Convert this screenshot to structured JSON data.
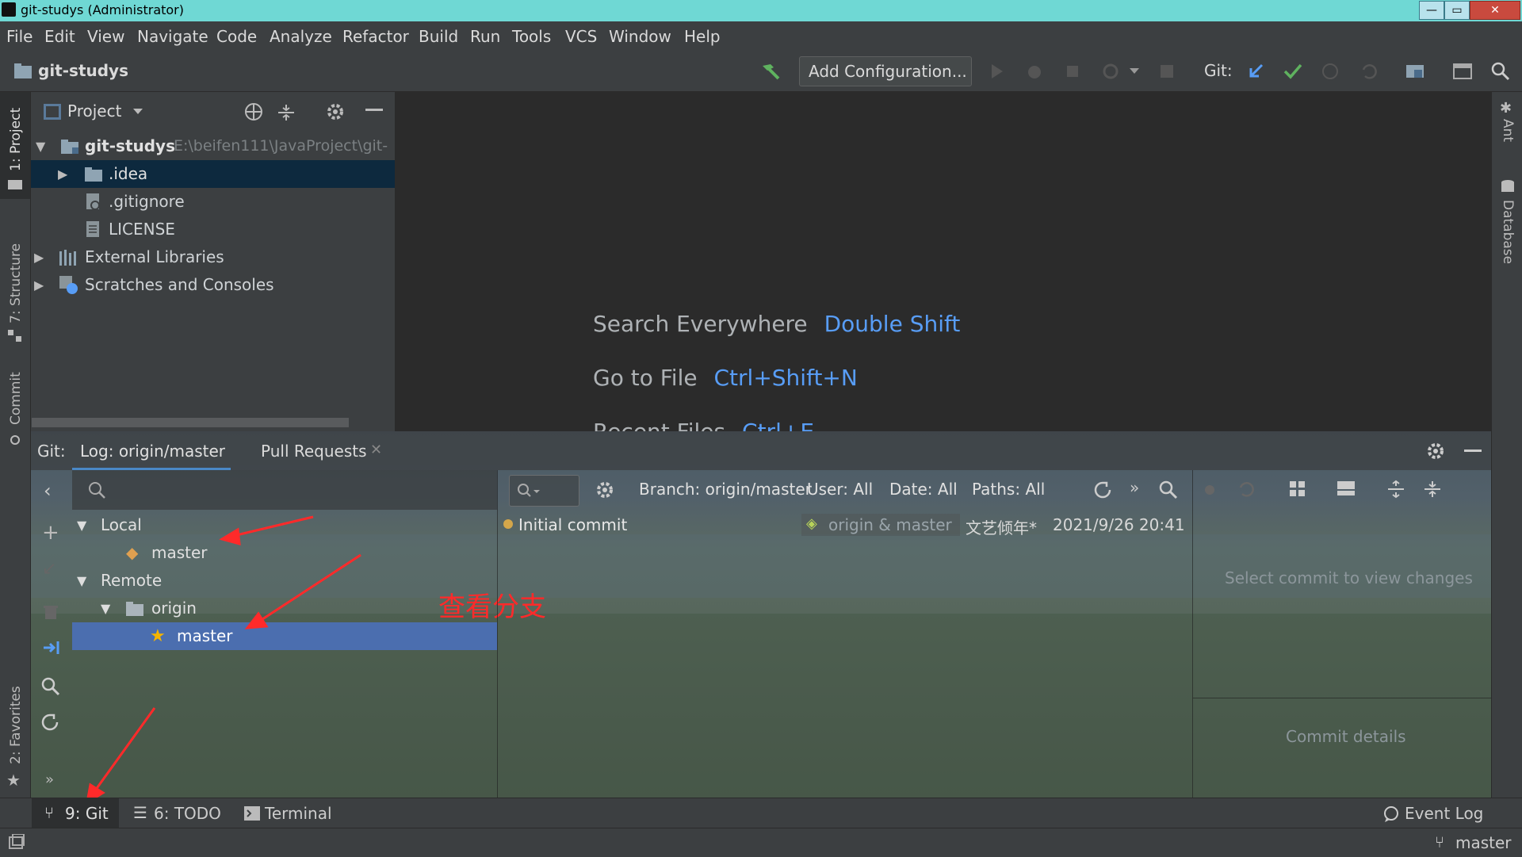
{
  "window": {
    "title": "git-studys (Administrator)",
    "min": "—",
    "max": "▭",
    "close": "✕"
  },
  "menu": [
    "File",
    "Edit",
    "View",
    "Navigate",
    "Code",
    "Analyze",
    "Refactor",
    "Build",
    "Run",
    "Tools",
    "VCS",
    "Window",
    "Help"
  ],
  "toolbar": {
    "project_name": "git-studys",
    "add_config": "Add Configuration...",
    "git_label": "Git:"
  },
  "left_stripe": {
    "project": "1: Project",
    "structure": "7: Structure",
    "commit": "Commit",
    "favorites": "2: Favorites"
  },
  "right_stripe": {
    "ant": "Ant",
    "database": "Database"
  },
  "project_panel": {
    "header": "Project",
    "tree": [
      {
        "label": "git-studys",
        "path": "E:\\beifen111\\JavaProject\\git-"
      },
      {
        "label": ".idea"
      },
      {
        "label": ".gitignore"
      },
      {
        "label": "LICENSE"
      },
      {
        "label": "External Libraries"
      },
      {
        "label": "Scratches and Consoles"
      }
    ]
  },
  "editor": {
    "hints": [
      {
        "label": "Search Everywhere",
        "shortcut": "Double Shift"
      },
      {
        "label": "Go to File",
        "shortcut": "Ctrl+Shift+N"
      },
      {
        "label": "Recent Files",
        "shortcut": "Ctrl+E"
      }
    ]
  },
  "git_panel": {
    "label": "Git:",
    "tabs": [
      "Log: origin/master",
      "Pull Requests"
    ],
    "branches": {
      "local": "Local",
      "local_master": "master",
      "remote": "Remote",
      "origin": "origin",
      "remote_master": "master"
    },
    "annotation": "查看分支",
    "filters": {
      "branch": "Branch: origin/master",
      "user": "User: All",
      "date": "Date: All",
      "paths": "Paths: All"
    },
    "commit": {
      "message": "Initial commit",
      "refs": "origin & master",
      "author": "文艺倾年*",
      "date": "2021/9/26 20:41"
    },
    "select_commit": "Select commit to view changes",
    "commit_details": "Commit details"
  },
  "bottom_bar": {
    "git": "9: Git",
    "todo": "6: TODO",
    "terminal": "Terminal",
    "event_log": "Event Log"
  },
  "status_bar": {
    "branch": "master"
  },
  "colors": {
    "accent": "#589df6",
    "selection": "#4b6eaf",
    "annotation": "#ff2a2a"
  }
}
